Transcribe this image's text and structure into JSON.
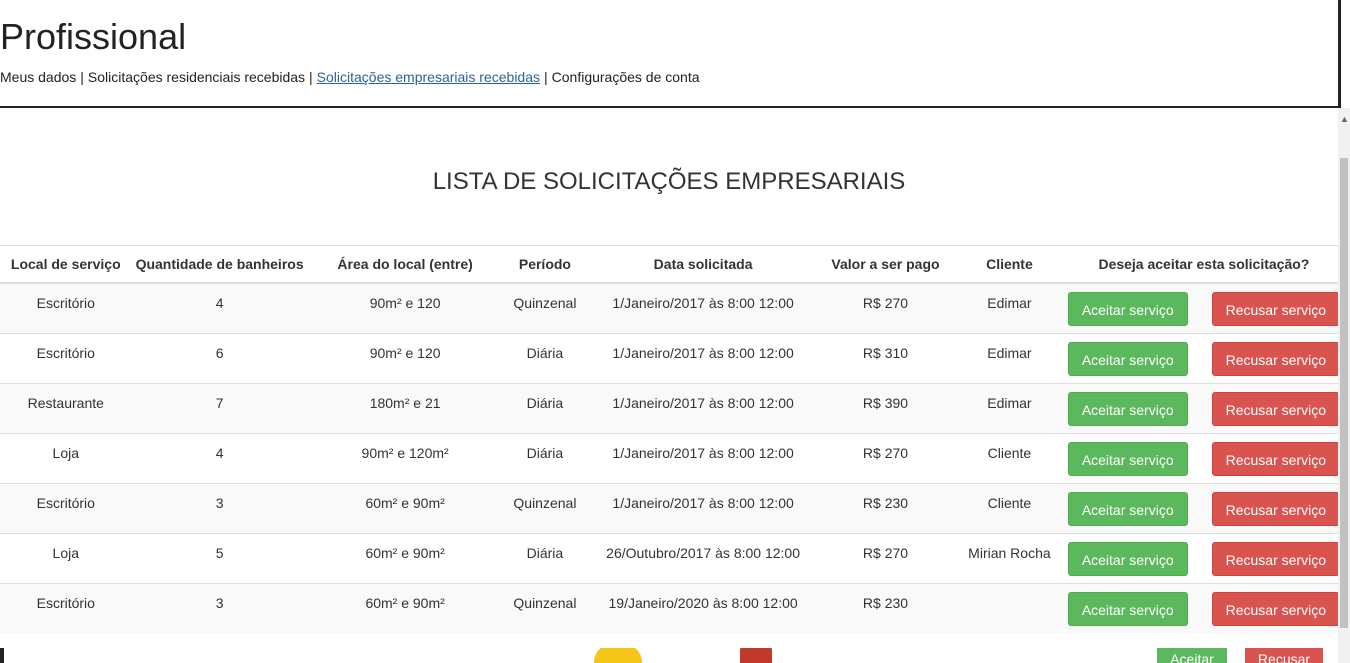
{
  "header": {
    "title": "Profissional",
    "nav": [
      {
        "label": "Meus dados",
        "active": false
      },
      {
        "label": "Solicitações residenciais recebidas",
        "active": false
      },
      {
        "label": "Solicitações empresariais recebidas",
        "active": true
      },
      {
        "label": "Configurações de conta",
        "active": false
      }
    ],
    "separator": "|"
  },
  "main": {
    "title": "LISTA DE SOLICITAÇÕES EMPRESARIAIS",
    "columns": [
      "Local de serviço",
      "Quantidade de banheiros",
      "Área do local (entre)",
      "Período",
      "Data solicitada",
      "Valor a ser pago",
      "Cliente",
      "Deseja aceitar esta solicitação?"
    ],
    "accept_label": "Aceitar serviço",
    "refuse_label": "Recusar serviço",
    "rows": [
      {
        "local": "Escritório",
        "banheiros": "4",
        "area": "90m² e 120",
        "periodo": "Quinzenal",
        "data": "1/Janeiro/2017 às 8:00 12:00",
        "valor": "R$ 270",
        "cliente": "Edimar"
      },
      {
        "local": "Escritório",
        "banheiros": "6",
        "area": "90m² e 120",
        "periodo": "Diária",
        "data": "1/Janeiro/2017 às 8:00 12:00",
        "valor": "R$ 310",
        "cliente": "Edimar"
      },
      {
        "local": "Restaurante",
        "banheiros": "7",
        "area": "180m² e 21",
        "periodo": "Diária",
        "data": "1/Janeiro/2017 às 8:00 12:00",
        "valor": "R$ 390",
        "cliente": "Edimar"
      },
      {
        "local": "Loja",
        "banheiros": "4",
        "area": "90m² e 120m²",
        "periodo": "Diária",
        "data": "1/Janeiro/2017 às 8:00 12:00",
        "valor": "R$ 270",
        "cliente": "Cliente"
      },
      {
        "local": "Escritório",
        "banheiros": "3",
        "area": "60m² e 90m²",
        "periodo": "Quinzenal",
        "data": "1/Janeiro/2017 às 8:00 12:00",
        "valor": "R$ 230",
        "cliente": "Cliente"
      },
      {
        "local": "Loja",
        "banheiros": "5",
        "area": "60m² e 90m²",
        "periodo": "Diária",
        "data": "26/Outubro/2017 às 8:00 12:00",
        "valor": "R$ 270",
        "cliente": "Mirian Rocha"
      },
      {
        "local": "Escritório",
        "banheiros": "3",
        "area": "60m² e 90m²",
        "periodo": "Quinzenal",
        "data": "19/Janeiro/2020 às 8:00 12:00",
        "valor": "R$ 230",
        "cliente": ""
      }
    ]
  },
  "underlying": {
    "accept_label": "Aceitar",
    "refuse_label": "Recusar"
  },
  "colors": {
    "accept": "#5cb85c",
    "refuse": "#d9534f",
    "active_link": "#2a6496"
  }
}
